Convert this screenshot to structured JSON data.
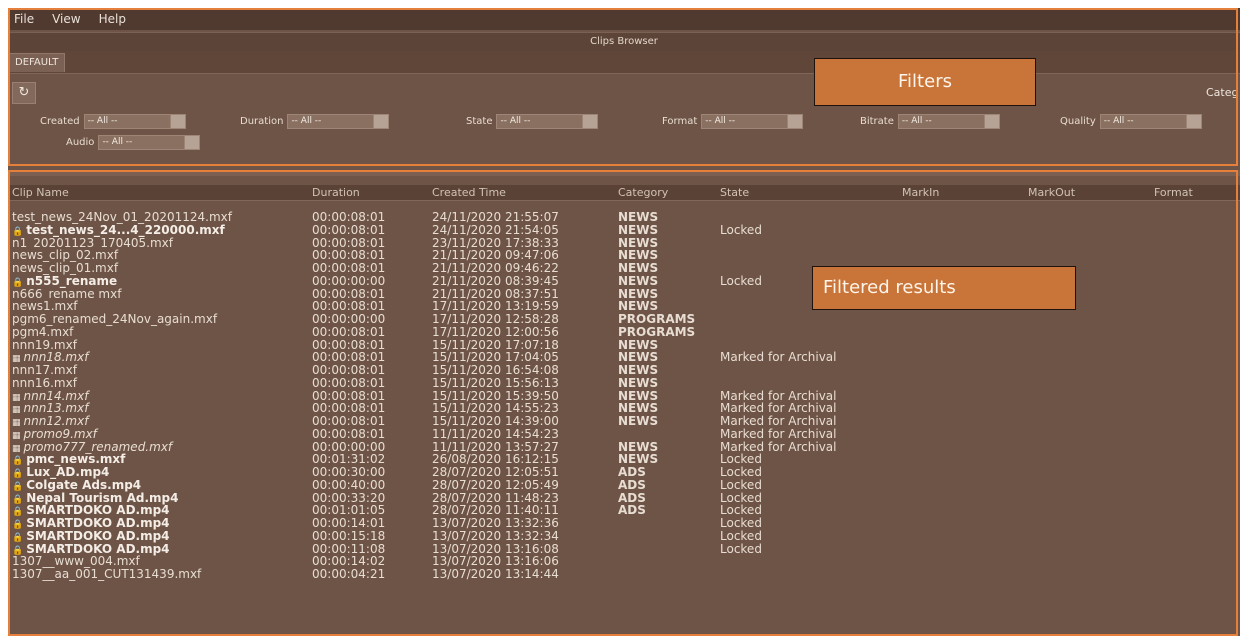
{
  "menu": [
    "File",
    "View",
    "Help"
  ],
  "window_title": "Clips Browser",
  "tab": "DEFAULT",
  "categories_label": "Categ",
  "filters": [
    {
      "label": "Created",
      "value": "-- All --"
    },
    {
      "label": "Duration",
      "value": "-- All --"
    },
    {
      "label": "State",
      "value": "-- All --"
    },
    {
      "label": "Format",
      "value": "-- All --"
    },
    {
      "label": "Bitrate",
      "value": "-- All --"
    },
    {
      "label": "Quality",
      "value": "-- All --"
    },
    {
      "label": "Audio",
      "value": "-- All --"
    }
  ],
  "callouts": {
    "filters": "Filters",
    "results": "Filtered results"
  },
  "columns": [
    "Clip Name",
    "Duration",
    "Created Time",
    "Category",
    "State",
    "MarkIn",
    "MarkOut",
    "Format"
  ],
  "rows": [
    {
      "name": "test_news_24Nov_01_20201124.mxf",
      "duration": "00:00:08:01",
      "created": "24/11/2020 21:55:07",
      "category": "NEWS",
      "state": "",
      "icon": ""
    },
    {
      "name": "test_news_24...4_220000.mxf",
      "duration": "00:00:08:01",
      "created": "24/11/2020 21:54:05",
      "category": "NEWS",
      "state": "Locked",
      "icon": "lock"
    },
    {
      "name": "n1_20201123_170405.mxf",
      "duration": "00:00:08:01",
      "created": "23/11/2020 17:38:33",
      "category": "NEWS",
      "state": "",
      "icon": ""
    },
    {
      "name": "news_clip_02.mxf",
      "duration": "00:00:08:01",
      "created": "21/11/2020 09:47:06",
      "category": "NEWS",
      "state": "",
      "icon": ""
    },
    {
      "name": "news_clip_01.mxf",
      "duration": "00:00:08:01",
      "created": "21/11/2020 09:46:22",
      "category": "NEWS",
      "state": "",
      "icon": ""
    },
    {
      "name": "n555_rename",
      "duration": "00:00:00:00",
      "created": "21/11/2020 08:39:45",
      "category": "NEWS",
      "state": "Locked",
      "icon": "lock"
    },
    {
      "name": "n666_rename mxf",
      "duration": "00:00:08:01",
      "created": "21/11/2020 08:37:51",
      "category": "NEWS",
      "state": "",
      "icon": ""
    },
    {
      "name": "news1.mxf",
      "duration": "00:00:08:01",
      "created": "17/11/2020 13:19:59",
      "category": "NEWS",
      "state": "",
      "icon": ""
    },
    {
      "name": "pgm6_renamed_24Nov_again.mxf",
      "duration": "00:00:00:00",
      "created": "17/11/2020 12:58:28",
      "category": "PROGRAMS",
      "state": "",
      "icon": ""
    },
    {
      "name": "pgm4.mxf",
      "duration": "00:00:08:01",
      "created": "17/11/2020 12:00:56",
      "category": "PROGRAMS",
      "state": "",
      "icon": ""
    },
    {
      "name": "nnn19.mxf",
      "duration": "00:00:08:01",
      "created": "15/11/2020 17:07:18",
      "category": "NEWS",
      "state": "",
      "icon": ""
    },
    {
      "name": "nnn18.mxf",
      "duration": "00:00:08:01",
      "created": "15/11/2020 17:04:05",
      "category": "NEWS",
      "state": "Marked for Archival",
      "icon": "archive"
    },
    {
      "name": "nnn17.mxf",
      "duration": "00:00:08:01",
      "created": "15/11/2020 16:54:08",
      "category": "NEWS",
      "state": "",
      "icon": ""
    },
    {
      "name": "nnn16.mxf",
      "duration": "00:00:08:01",
      "created": "15/11/2020 15:56:13",
      "category": "NEWS",
      "state": "",
      "icon": ""
    },
    {
      "name": "nnn14.mxf",
      "duration": "00:00:08:01",
      "created": "15/11/2020 15:39:50",
      "category": "NEWS",
      "state": "Marked for Archival",
      "icon": "archive"
    },
    {
      "name": "nnn13.mxf",
      "duration": "00:00:08:01",
      "created": "15/11/2020 14:55:23",
      "category": "NEWS",
      "state": "Marked for Archival",
      "icon": "archive"
    },
    {
      "name": "nnn12.mxf",
      "duration": "00:00:08:01",
      "created": "15/11/2020 14:39:00",
      "category": "NEWS",
      "state": "Marked for Archival",
      "icon": "archive"
    },
    {
      "name": "promo9.mxf",
      "duration": "00:00:08:01",
      "created": "11/11/2020 14:54:23",
      "category": "",
      "state": "Marked for Archival",
      "icon": "archive"
    },
    {
      "name": "promo777_renamed.mxf",
      "duration": "00:00:00:00",
      "created": "11/11/2020 13:57:27",
      "category": "NEWS",
      "state": "Marked for Archival",
      "icon": "archive"
    },
    {
      "name": "pmc_news.mxf",
      "duration": "00:01:31:02",
      "created": "26/08/2020 16:12:15",
      "category": "NEWS",
      "state": "Locked",
      "icon": "lock"
    },
    {
      "name": "Lux_AD.mp4",
      "duration": "00:00:30:00",
      "created": "28/07/2020 12:05:51",
      "category": "ADS",
      "state": "Locked",
      "icon": "lock"
    },
    {
      "name": "Colgate Ads.mp4",
      "duration": "00:00:40:00",
      "created": "28/07/2020 12:05:49",
      "category": "ADS",
      "state": "Locked",
      "icon": "lock"
    },
    {
      "name": "Nepal Tourism Ad.mp4",
      "duration": "00:00:33:20",
      "created": "28/07/2020 11:48:23",
      "category": "ADS",
      "state": "Locked",
      "icon": "lock"
    },
    {
      "name": "SMARTDOKO AD.mp4",
      "duration": "00:01:01:05",
      "created": "28/07/2020 11:40:11",
      "category": "ADS",
      "state": "Locked",
      "icon": "lock"
    },
    {
      "name": "SMARTDOKO AD.mp4",
      "duration": "00:00:14:01",
      "created": "13/07/2020 13:32:36",
      "category": "",
      "state": "Locked",
      "icon": "lock"
    },
    {
      "name": "SMARTDOKO AD.mp4",
      "duration": "00:00:15:18",
      "created": "13/07/2020 13:32:34",
      "category": "",
      "state": "Locked",
      "icon": "lock"
    },
    {
      "name": "SMARTDOKO AD.mp4",
      "duration": "00:00:11:08",
      "created": "13/07/2020 13:16:08",
      "category": "",
      "state": "Locked",
      "icon": "lock"
    },
    {
      "name": "1307__www_004.mxf",
      "duration": "00:00:14:02",
      "created": "13/07/2020 13:16:06",
      "category": "",
      "state": "",
      "icon": ""
    },
    {
      "name": "1307__aa_001_CUT131439.mxf",
      "duration": "00:00:04:21",
      "created": "13/07/2020 13:14:44",
      "category": "",
      "state": "",
      "icon": ""
    }
  ]
}
